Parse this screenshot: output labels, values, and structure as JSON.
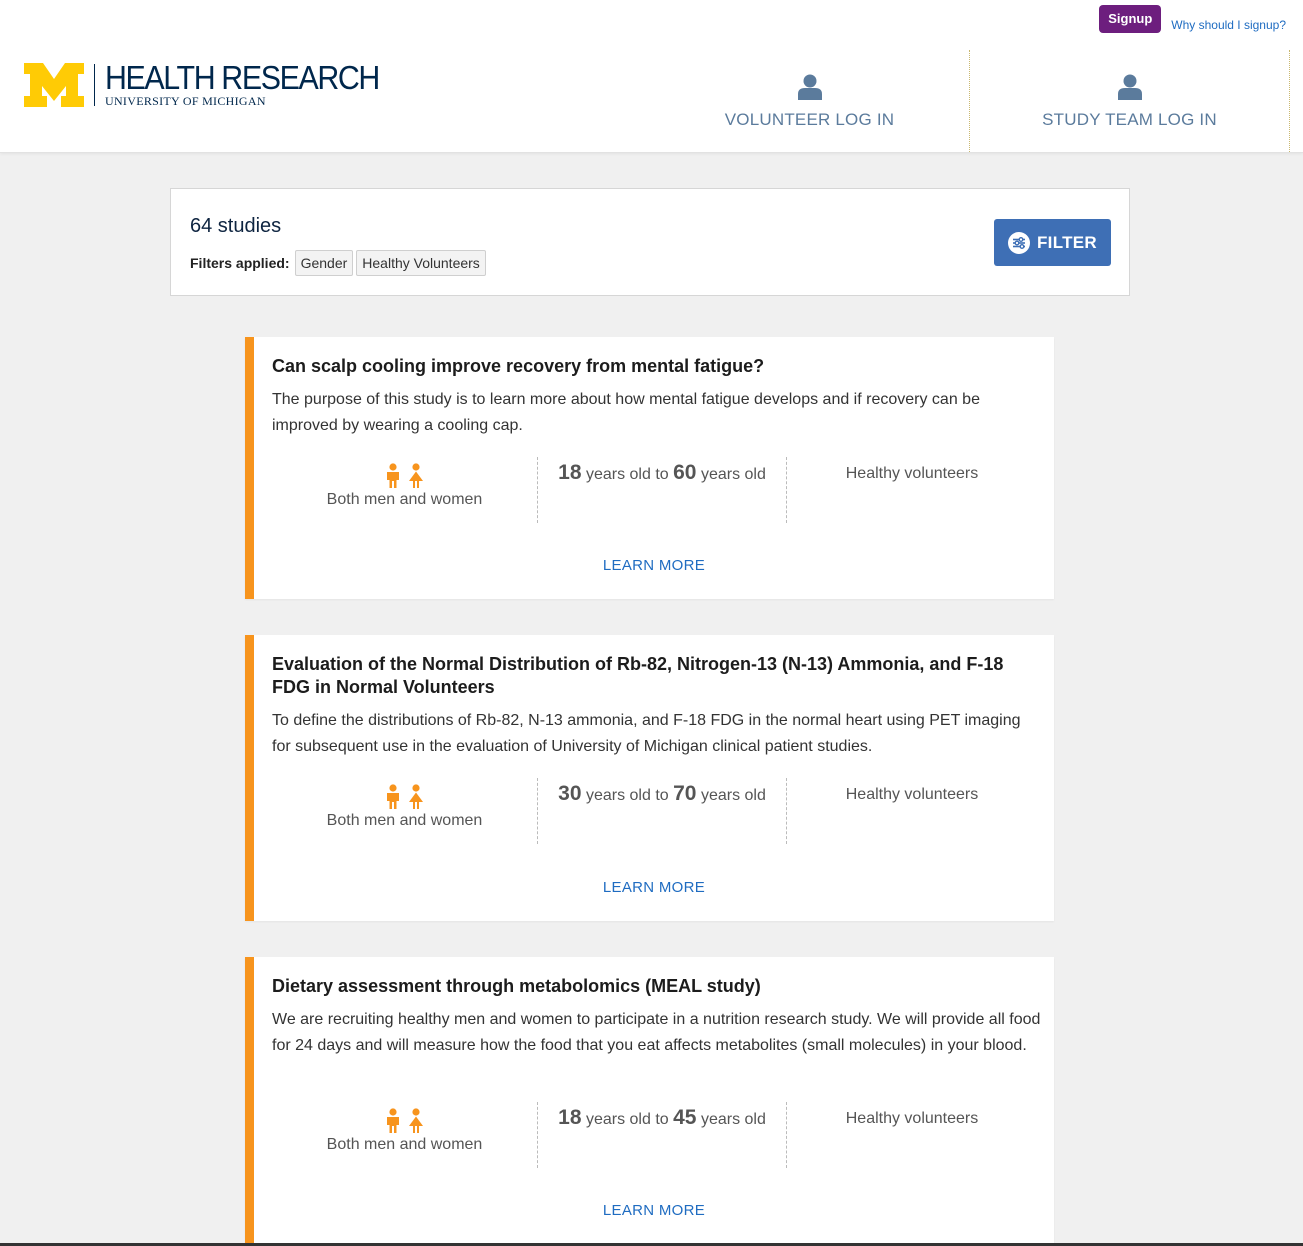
{
  "topbar": {
    "signup_label": "Signup",
    "why_label": "Why should I signup?"
  },
  "brand": {
    "title": "HEALTH RESEARCH",
    "subtitle": "UNIVERSITY OF MICHIGAN",
    "maize": "#ffcb05",
    "blue": "#00274c"
  },
  "nav": {
    "volunteer_login": "VOLUNTEER LOG IN",
    "study_team_login": "STUDY TEAM LOG IN"
  },
  "summary": {
    "count_text": "64 studies",
    "filters_label": "Filters applied:",
    "chips": [
      "Gender",
      "Healthy Volunteers"
    ],
    "filter_button": "FILTER"
  },
  "studies": [
    {
      "title": "Can scalp cooling improve recovery from mental fatigue?",
      "description": "The purpose of this study is to learn more about how mental fatigue develops and if recovery can be improved by wearing a cooling cap.",
      "gender": "Both men and women",
      "age_min": "18",
      "age_max": "60",
      "age_mid": "years old to",
      "age_end": "years old",
      "type": "Healthy volunteers",
      "learn_more": "LEARN MORE"
    },
    {
      "title": "Evaluation of the Normal Distribution of Rb-82, Nitrogen-13 (N-13) Ammonia, and F-18 FDG in Normal Volunteers",
      "description": "To define the distributions of Rb-82, N-13 ammonia, and F-18 FDG in the normal heart using PET imaging for subsequent use in the evaluation of University of Michigan clinical patient studies.",
      "gender": "Both men and women",
      "age_min": "30",
      "age_max": "70",
      "age_mid": "years old to",
      "age_end": "years old",
      "type": "Healthy volunteers",
      "learn_more": "LEARN MORE"
    },
    {
      "title": "Dietary assessment through metabolomics (MEAL study)",
      "description": "We are recruiting healthy men and women to participate in a nutrition research study. We will provide all food for 24 days and will measure how the food that you eat affects metabolites (small molecules) in your blood.",
      "gender": "Both men and women",
      "age_min": "18",
      "age_max": "45",
      "age_mid": "years old to",
      "age_end": "years old",
      "type": "Healthy volunteers",
      "learn_more": "LEARN MORE"
    }
  ],
  "colors": {
    "accent_orange": "#f7941d",
    "signup_purple": "#6d1e7e",
    "filter_blue": "#3e6fb5",
    "link_blue": "#1f6cc1"
  }
}
